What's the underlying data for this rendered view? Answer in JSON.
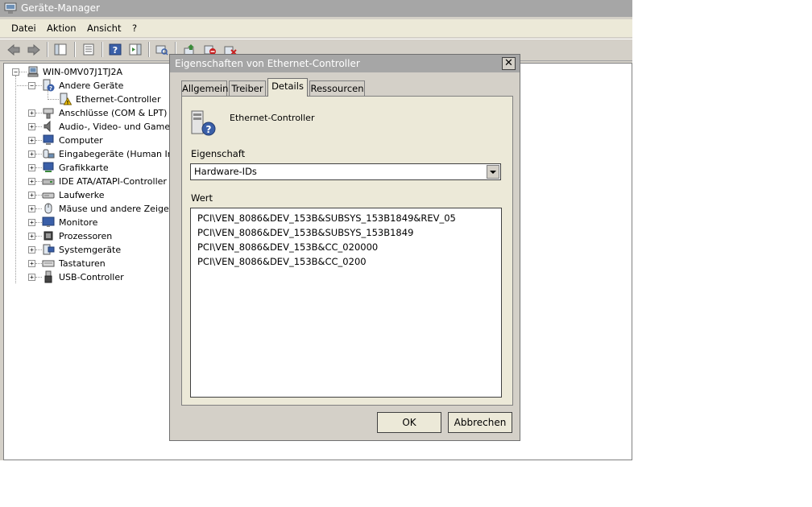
{
  "window": {
    "title": "Geräte-Manager"
  },
  "menu": [
    "Datei",
    "Aktion",
    "Ansicht",
    "?"
  ],
  "tree": {
    "root": "WIN-0MV07J1TJ2A",
    "items": [
      {
        "label": "Andere Geräte",
        "expanded": true
      },
      {
        "label": "Ethernet-Controller",
        "child": true
      },
      {
        "label": "Anschlüsse (COM & LPT)"
      },
      {
        "label": "Audio-, Video- und Gamecontroller"
      },
      {
        "label": "Computer"
      },
      {
        "label": "Eingabegeräte (Human Interface Devices)"
      },
      {
        "label": "Grafikkarte"
      },
      {
        "label": "IDE ATA/ATAPI-Controller"
      },
      {
        "label": "Laufwerke"
      },
      {
        "label": "Mäuse und andere Zeigegeräte"
      },
      {
        "label": "Monitore"
      },
      {
        "label": "Prozessoren"
      },
      {
        "label": "Systemgeräte"
      },
      {
        "label": "Tastaturen"
      },
      {
        "label": "USB-Controller"
      }
    ]
  },
  "dialog": {
    "title": "Eigenschaften von Ethernet-Controller",
    "close": "✕",
    "tabs": [
      "Allgemein",
      "Treiber",
      "Details",
      "Ressourcen"
    ],
    "active_tab": "Details",
    "device_name": "Ethernet-Controller",
    "property_label": "Eigenschaft",
    "property_value": "Hardware-IDs",
    "value_label": "Wert",
    "values": [
      "PCI\\VEN_8086&DEV_153B&SUBSYS_153B1849&REV_05",
      "PCI\\VEN_8086&DEV_153B&SUBSYS_153B1849",
      "PCI\\VEN_8086&DEV_153B&CC_020000",
      "PCI\\VEN_8086&DEV_153B&CC_0200"
    ],
    "ok": "OK",
    "cancel": "Abbrechen"
  }
}
